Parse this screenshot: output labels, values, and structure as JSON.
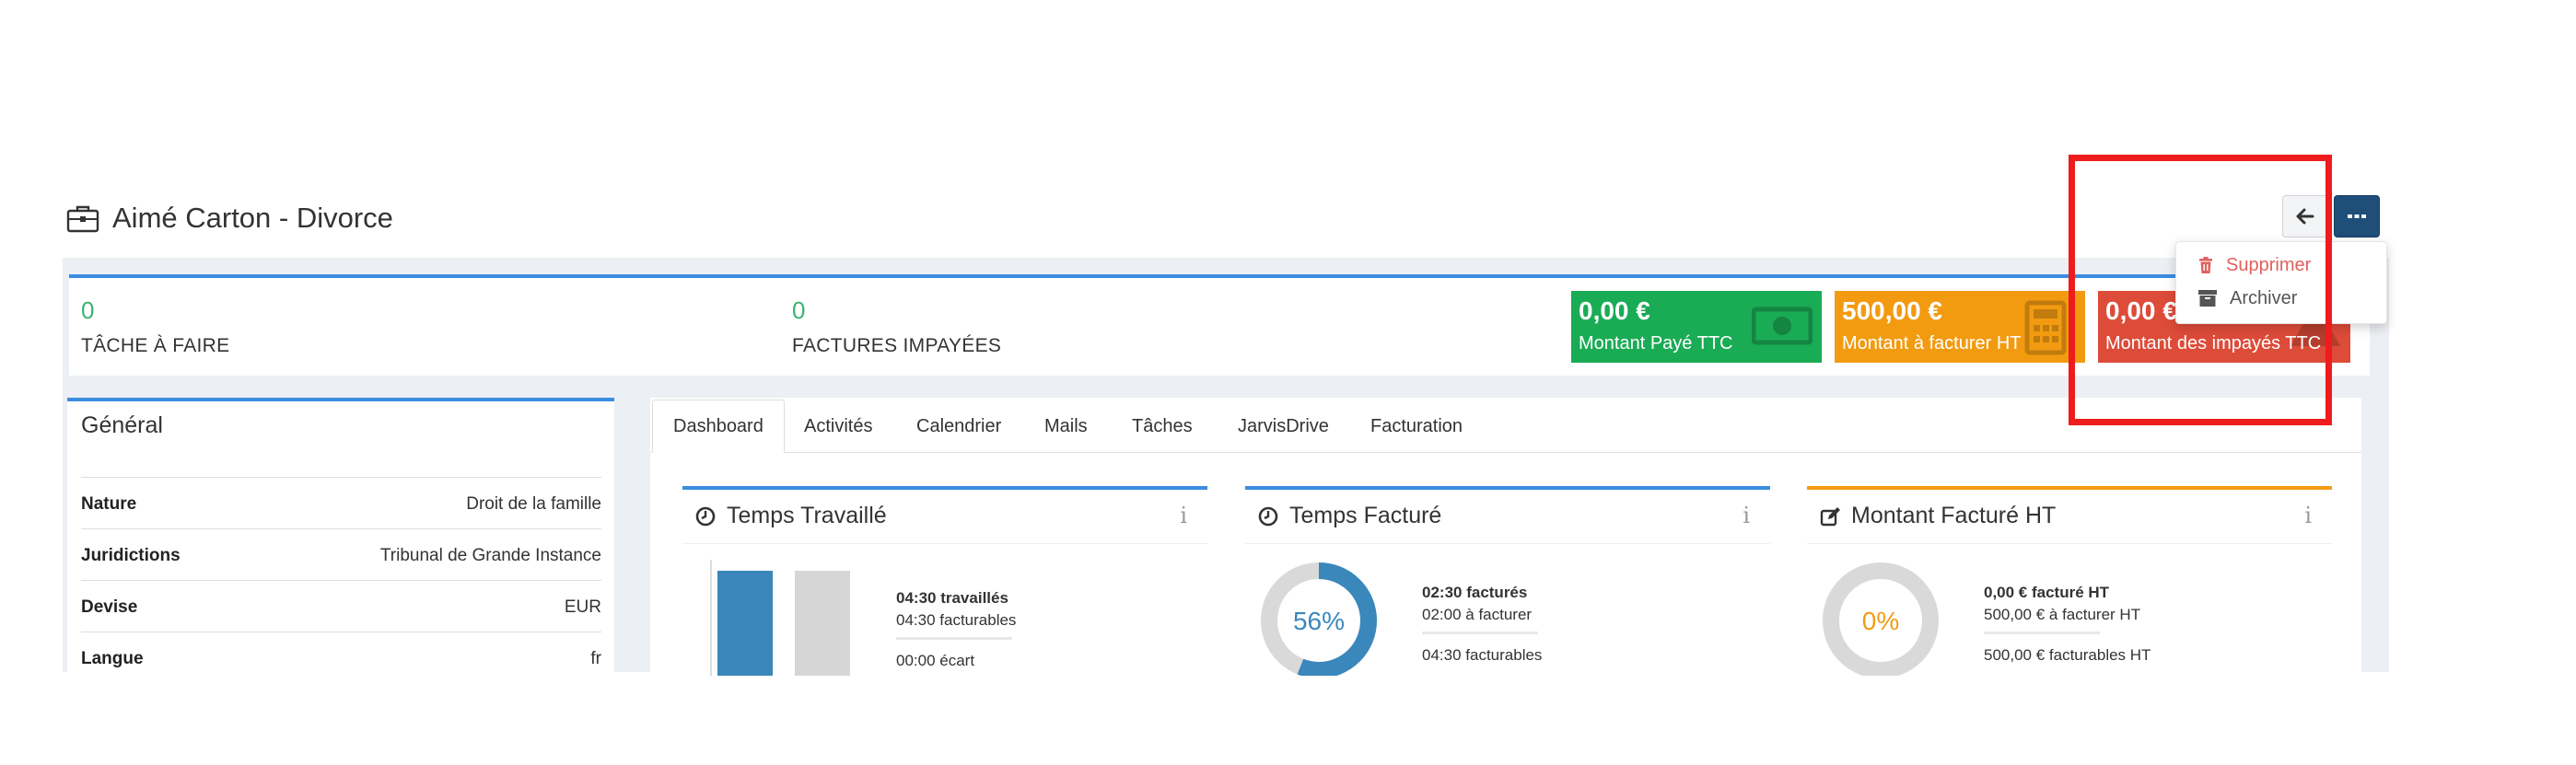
{
  "header": {
    "title": "Aimé Carton - Divorce"
  },
  "actions_menu": {
    "items": [
      {
        "label": "Supprimer",
        "icon": "trash-icon",
        "color": "#e0605e"
      },
      {
        "label": "Archiver",
        "icon": "archive-icon",
        "color": "#555555"
      }
    ]
  },
  "stats": {
    "tasks": {
      "value": "0",
      "label": "TÂCHE À FAIRE"
    },
    "unpaid_invoices": {
      "value": "0",
      "label": "FACTURES IMPAYÉES"
    },
    "tiles": [
      {
        "amount": "0,00 €",
        "label": "Montant Payé TTC",
        "color": "#1aab55",
        "icon": "money-icon"
      },
      {
        "amount": "500,00 €",
        "label": "Montant à facturer HT",
        "color": "#f29b11",
        "icon": "calculator-icon"
      },
      {
        "amount": "0,00 €",
        "label": "Montant des impayés TTC",
        "color": "#dd4b39",
        "icon": "warning-icon"
      }
    ]
  },
  "general": {
    "title": "Général",
    "rows": [
      {
        "key": "Nature",
        "value": "Droit de la famille"
      },
      {
        "key": "Juridictions",
        "value": "Tribunal de Grande Instance"
      },
      {
        "key": "Devise",
        "value": "EUR"
      },
      {
        "key": "Langue",
        "value": "fr"
      }
    ]
  },
  "tabs": [
    {
      "label": "Dashboard",
      "active": true
    },
    {
      "label": "Activités"
    },
    {
      "label": "Calendrier"
    },
    {
      "label": "Mails"
    },
    {
      "label": "Tâches"
    },
    {
      "label": "JarvisDrive"
    },
    {
      "label": "Facturation"
    }
  ],
  "widgets": {
    "worked": {
      "title": "Temps Travaillé",
      "info": "i",
      "lines": [
        "04:30 travaillés",
        "04:30 facturables",
        "00:00 écart"
      ],
      "bars": [
        {
          "name": "travaillés",
          "color": "#3a87bc"
        },
        {
          "name": "facturables",
          "color": "#d6d6d6"
        }
      ]
    },
    "billed": {
      "title": "Temps Facturé",
      "info": "i",
      "percent": "56%",
      "fraction": 0.56,
      "lines": [
        "02:30 facturés",
        "02:00 à facturer",
        "04:30 facturables"
      ]
    },
    "amount": {
      "title": "Montant Facturé HT",
      "info": "i",
      "percent": "0%",
      "fraction": 0.0,
      "lines": [
        "0,00 € facturé HT",
        "500,00 € à facturer HT",
        "500,00 € facturables HT"
      ]
    }
  },
  "colors": {
    "accent_blue": "#3a8dde",
    "green": "#3cb371",
    "orange": "#f39c12",
    "highlight": "#ee1c1c"
  }
}
